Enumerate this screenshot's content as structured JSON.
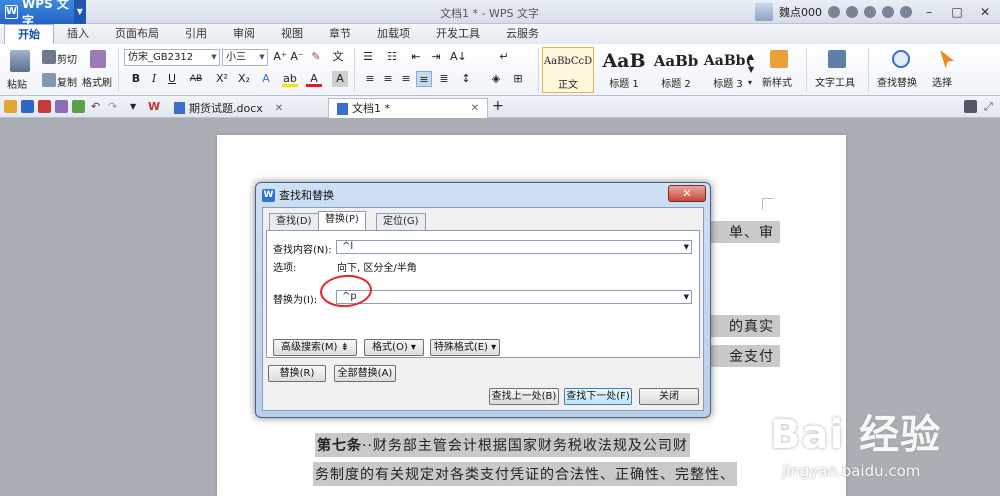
{
  "app": {
    "menu_label": "WPS 文字",
    "window_title": "文档1 * - WPS 文字",
    "user_name": "魏点000"
  },
  "tabs": [
    "开始",
    "插入",
    "页面布局",
    "引用",
    "审阅",
    "视图",
    "章节",
    "加载项",
    "开发工具",
    "云服务"
  ],
  "ribbon": {
    "paste": "粘贴",
    "cut": "剪切",
    "copy": "复制",
    "format_painter": "格式刷",
    "font_name": "仿宋_GB2312",
    "font_size": "小三",
    "styles": [
      {
        "sample": "AaBbCcD",
        "name": "正文"
      },
      {
        "sample": "AaB",
        "name": "标题 1"
      },
      {
        "sample": "AaBb",
        "name": "标题 2"
      },
      {
        "sample": "AaBb(",
        "name": "标题 3"
      }
    ],
    "new_style": "新样式",
    "text_tools": "文字工具",
    "find_replace": "查找替换",
    "select": "选择"
  },
  "doc_tabs": [
    {
      "label": "期货试题.docx"
    },
    {
      "label": "文档1 *"
    }
  ],
  "document": {
    "line1_tail": "单、审",
    "line2_tail": "的真实",
    "line3_tail": "金支付",
    "article_label": "第七条",
    "article_text": "··财务部主管会计根据国家财务税收法规及公司财",
    "line5": "务制度的有关规定对各类支付凭证的合法性、正确性、完整性、"
  },
  "dialog": {
    "title": "查找和替换",
    "tabs": [
      "查找(D)",
      "替换(P)",
      "定位(G)"
    ],
    "find_label": "查找内容(N):",
    "find_value": "^l",
    "options_label": "选项:",
    "options_value": "向下, 区分全/半角",
    "replace_label": "替换为(I):",
    "replace_value": "^p",
    "advanced_button": "高级搜索(M) ⇟",
    "format_button": "格式(O) ▾",
    "special_button": "特殊格式(E) ▾",
    "replace_button": "替换(R)",
    "replace_all_button": "全部替换(A)",
    "find_prev_button": "查找上一处(B)",
    "find_next_button": "查找下一处(F)",
    "close_button": "关闭"
  },
  "watermark": {
    "logo": "Bai 经验",
    "url": "jingyan.baidu.com"
  }
}
